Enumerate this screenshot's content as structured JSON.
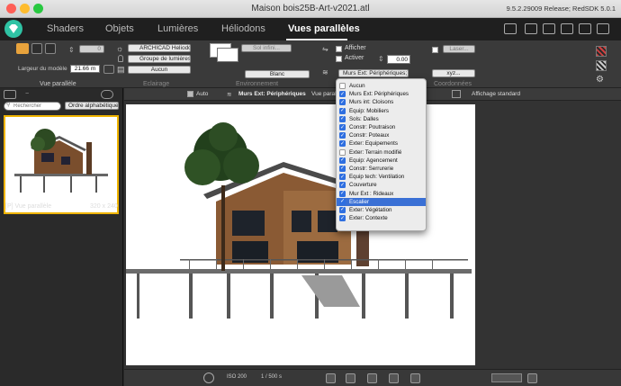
{
  "window": {
    "title": "Maison bois25B-Art-v2021.atl",
    "version": "9.5.2.29009 Release; RedSDK 5.0.1"
  },
  "tabs": [
    {
      "label": "Shaders",
      "active": false
    },
    {
      "label": "Objets",
      "active": false
    },
    {
      "label": "Lumières",
      "active": false
    },
    {
      "label": "Héliodons",
      "active": false
    },
    {
      "label": "Vues parallèles",
      "active": true
    }
  ],
  "toolbar": {
    "model_width_label": "Largeur du modèle",
    "model_width_value": "21.66 m",
    "number_field": "0",
    "section_vue": "Vue parallèle",
    "lighting": {
      "sun": "ARCHICAD Heliodon",
      "group": "Groupe de lumières",
      "none": "Aucun",
      "label": "Eclairage"
    },
    "environment": {
      "ground": "Sol infini...",
      "color": "Blanc",
      "label": "Environnement"
    },
    "display": {
      "afficher": "Afficher",
      "activer": "Activer",
      "value": "0.00",
      "layers": "Murs Ext: Périphériques;"
    },
    "coords": {
      "laser": "Laser...",
      "xyz": "xyz...",
      "label": "Coordonnées"
    }
  },
  "left_panel": {
    "search_placeholder": "Rechercher",
    "sort": "Ordre alphabétique",
    "thumb_name": "[P] Vue parallèle",
    "thumb_size": "320 x 240"
  },
  "viewbar": {
    "auto": "Auto",
    "layer": "Murs Ext: Périphériques",
    "vue": "Vue paral",
    "display": "Affichage standard"
  },
  "layers_menu": [
    {
      "label": "Aucun",
      "checked": false,
      "selected": false
    },
    {
      "label": "Murs Ext: Périphériques",
      "checked": true,
      "selected": false
    },
    {
      "label": "Murs int: Cloisons",
      "checked": true,
      "selected": false
    },
    {
      "label": "Equip: Mobiliers",
      "checked": true,
      "selected": false
    },
    {
      "label": "Sols: Dalles",
      "checked": true,
      "selected": false
    },
    {
      "label": "Constr: Poutraison",
      "checked": true,
      "selected": false
    },
    {
      "label": "Constr: Poteaux",
      "checked": true,
      "selected": false
    },
    {
      "label": "Exter: Equipements",
      "checked": true,
      "selected": false
    },
    {
      "label": "Exter: Terrain modifié",
      "checked": false,
      "selected": false
    },
    {
      "label": "Equip: Agencement",
      "checked": true,
      "selected": false
    },
    {
      "label": "Constr: Serrurerie",
      "checked": true,
      "selected": false
    },
    {
      "label": "Equip tech: Ventilation",
      "checked": true,
      "selected": false
    },
    {
      "label": "Couverture",
      "checked": true,
      "selected": false
    },
    {
      "label": "Mur Ext : Rideaux",
      "checked": true,
      "selected": false
    },
    {
      "label": "Escalier",
      "checked": true,
      "selected": true
    },
    {
      "label": "Exter: Végétation",
      "checked": true,
      "selected": false
    },
    {
      "label": "Exter: Contexte",
      "checked": true,
      "selected": false
    }
  ],
  "bottombar": {
    "iso": "ISO 200",
    "scale": "1 / 500 s"
  }
}
